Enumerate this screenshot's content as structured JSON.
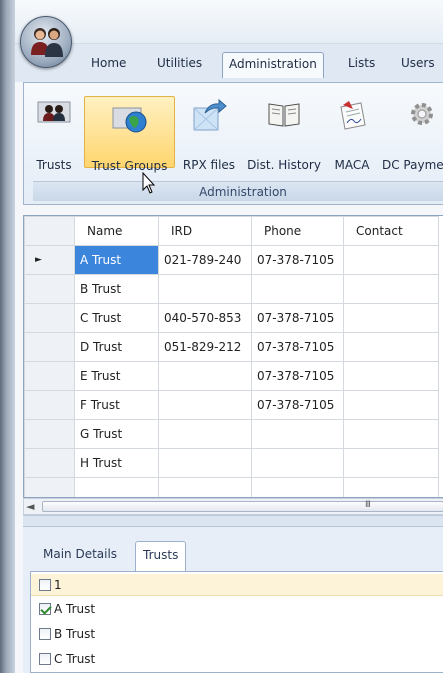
{
  "ribbon_tabs": [
    "Home",
    "Utilities",
    "Administration",
    "Lists",
    "Users"
  ],
  "active_tab": "Administration",
  "ribbon_buttons": [
    {
      "label": "Trusts",
      "icon": "people-icon"
    },
    {
      "label": "Trust Groups",
      "icon": "globe-group-icon"
    },
    {
      "label": "RPX files",
      "icon": "export-arrow-icon"
    },
    {
      "label": "Dist. History",
      "icon": "book-icon"
    },
    {
      "label": "MACA",
      "icon": "signed-document-icon"
    },
    {
      "label": "DC Payme",
      "icon": "gear-icon"
    }
  ],
  "ribbon_group_label": "Administration",
  "grid": {
    "columns": [
      "Name",
      "IRD",
      "Phone",
      "Contact"
    ],
    "rows": [
      {
        "name": "A Trust",
        "ird": "021-789-240",
        "phone": "07-378-7105",
        "contact": ""
      },
      {
        "name": "B Trust",
        "ird": "",
        "phone": "",
        "contact": ""
      },
      {
        "name": "C Trust",
        "ird": "040-570-853",
        "phone": "07-378-7105",
        "contact": ""
      },
      {
        "name": "D Trust",
        "ird": "051-829-212",
        "phone": "07-378-7105",
        "contact": ""
      },
      {
        "name": "E Trust",
        "ird": "",
        "phone": "07-378-7105",
        "contact": ""
      },
      {
        "name": "F Trust",
        "ird": "",
        "phone": "07-378-7105",
        "contact": ""
      },
      {
        "name": "G Trust",
        "ird": "",
        "phone": "",
        "contact": ""
      },
      {
        "name": "H Trust",
        "ird": "",
        "phone": "",
        "contact": ""
      }
    ],
    "current_row_marker": "►"
  },
  "scrollbar": {
    "left_arrow": "◄",
    "grip": "III"
  },
  "bottom_tabs": [
    "Main Details",
    "Trusts"
  ],
  "active_bottom_tab": "Trusts",
  "checklist": [
    {
      "label": "1",
      "checked": false
    },
    {
      "label": "A Trust",
      "checked": true
    },
    {
      "label": "B Trust",
      "checked": false
    },
    {
      "label": "C Trust",
      "checked": false
    }
  ]
}
